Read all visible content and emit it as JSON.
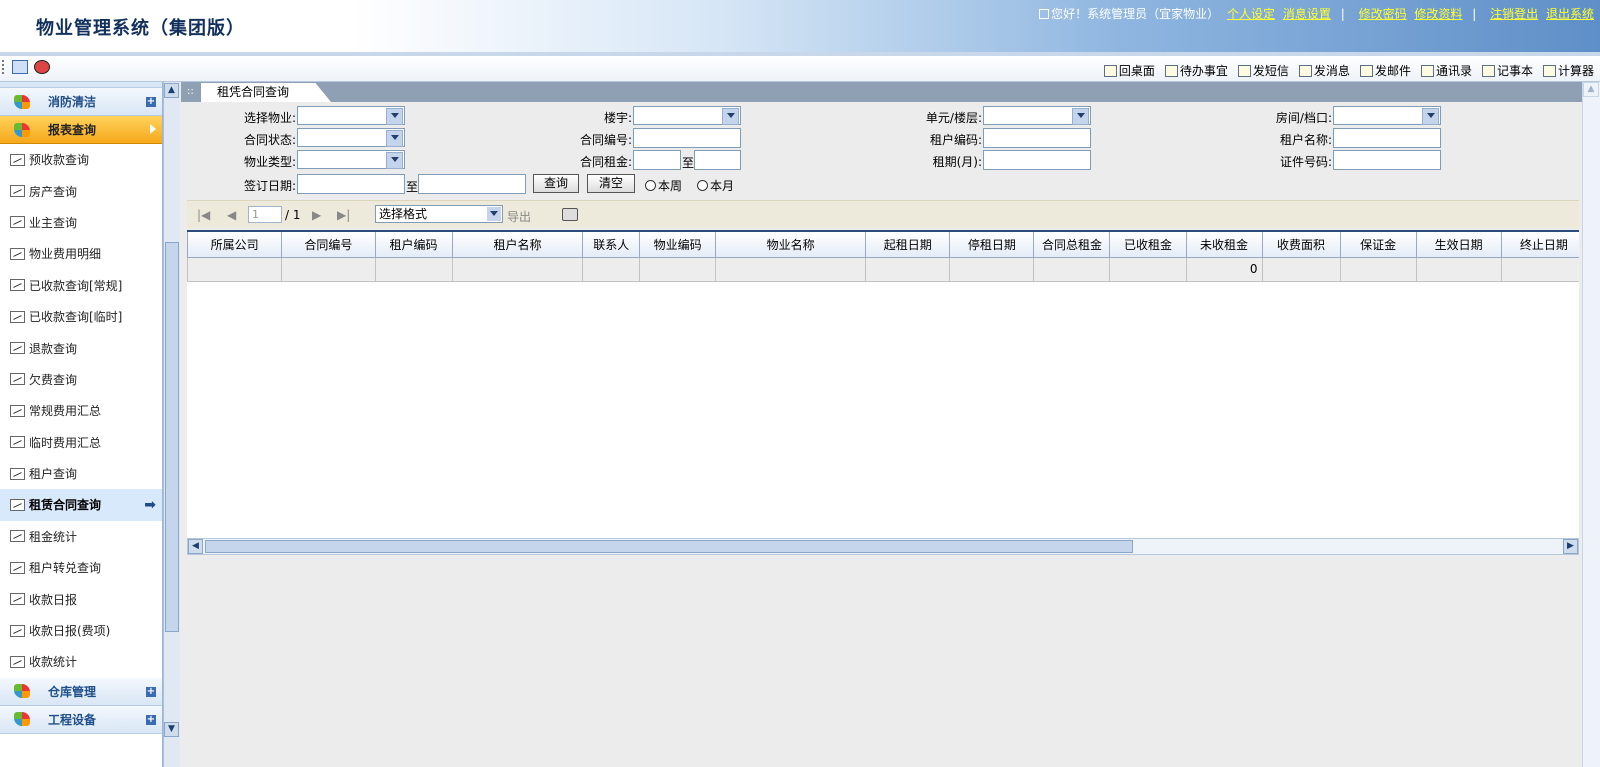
{
  "header": {
    "title": "物业管理系统（集团版）",
    "greeting": "您好！系统管理员（宜家物业）",
    "links": [
      "个人设定",
      "消息设置",
      "修改密码",
      "修改资料",
      "注销登出",
      "退出系统"
    ],
    "sep": "|"
  },
  "toolbar": {
    "right_items": [
      "回桌面",
      "待办事宜",
      "发短信",
      "发消息",
      "发邮件",
      "通讯录",
      "记事本",
      "计算器"
    ]
  },
  "sidebar": {
    "groups": {
      "fire_clean": "消防清洁",
      "reports": "报表查询",
      "warehouse": "仓库管理",
      "engineering": "工程设备"
    },
    "items": [
      "预收款查询",
      "房产查询",
      "业主查询",
      "物业费用明细",
      "已收款查询[常规]",
      "已收款查询[临时]",
      "退款查询",
      "欠费查询",
      "常规费用汇总",
      "临时费用汇总",
      "租户查询",
      "租赁合同查询",
      "租金统计",
      "租户转兑查询",
      "收款日报",
      "收款日报(费项)",
      "收款统计"
    ],
    "selected_index": 11
  },
  "tab": {
    "label": "租凭合同查询"
  },
  "filters": {
    "select_property": "选择物业:",
    "building": "楼宇:",
    "unit_floor": "单元/楼层:",
    "room": "房间/档口:",
    "contract_status": "合同状态:",
    "contract_no": "合同编号:",
    "tenant_code": "租户编码:",
    "tenant_name": "租户名称:",
    "property_type": "物业类型:",
    "contract_rent": "合同租金:",
    "lease_months": "租期(月):",
    "id_no": "证件号码:",
    "sign_date": "签订日期:",
    "to": "至",
    "query_btn": "查询",
    "clear_btn": "清空",
    "this_week": "本周",
    "this_month": "本月"
  },
  "pager": {
    "page_value": "1",
    "page_total": "/ 1",
    "format_select": "选择格式",
    "export": "导出"
  },
  "grid": {
    "columns": [
      "所属公司",
      "合同编号",
      "租户编码",
      "租户名称",
      "联系人",
      "物业编码",
      "物业名称",
      "起租日期",
      "停租日期",
      "合同总租金",
      "已收租金",
      "未收租金",
      "收费面积",
      "保证金",
      "生效日期",
      "终止日期"
    ],
    "summary_row": [
      "",
      "",
      "",
      "",
      "",
      "",
      "",
      "",
      "",
      "",
      "",
      "0",
      "",
      "",
      "",
      ""
    ]
  }
}
